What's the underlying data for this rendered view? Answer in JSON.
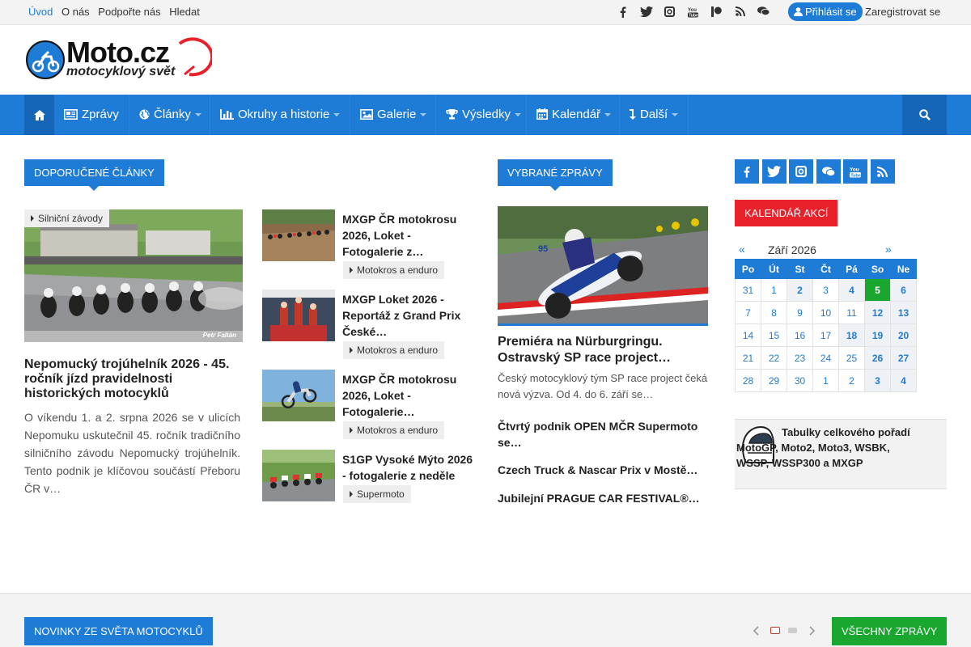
{
  "topbar": {
    "links": [
      "Úvod",
      "O nás",
      "Podpořte nás",
      "Hledat"
    ],
    "social_icons": [
      "facebook-icon",
      "twitter-icon",
      "instagram-icon",
      "youtube-icon",
      "patreon-icon",
      "rss-icon",
      "chat-icon"
    ],
    "login": "Přihlásit se",
    "register": "Zaregistrovat se"
  },
  "logo": {
    "name": "Moto.cz",
    "tagline": "motocyklový svět"
  },
  "nav": {
    "items": [
      {
        "label": "Zprávy",
        "icon": "newspaper-icon",
        "dropdown": false
      },
      {
        "label": "Články",
        "icon": "globe-icon",
        "dropdown": true
      },
      {
        "label": "Okruhy a historie",
        "icon": "bar-chart-icon",
        "dropdown": true
      },
      {
        "label": "Galerie",
        "icon": "image-icon",
        "dropdown": true
      },
      {
        "label": "Výsledky",
        "icon": "trophy-icon",
        "dropdown": true
      },
      {
        "label": "Kalendář",
        "icon": "calendar-icon",
        "dropdown": true
      },
      {
        "label": "Další",
        "icon": "arrow-down-icon",
        "dropdown": true
      }
    ]
  },
  "recommended": {
    "header": "DOPORUČENÉ ČLÁNKY",
    "featured": {
      "badge": "Silniční závody",
      "title": "Nepomucký trojúhelník 2026 - 45. ročník jízd pravidelnosti historických motocyklů",
      "excerpt": "O víkendu 1. a 2. srpna 2026 se v ulicích Nepomuku uskutečnil 45. ročník tradičního silničního závodu Nepomucký trojúhelník. Tento podnik je klíčovou součástí Přeboru ČR v…",
      "photo_credit": "Petr Faltán"
    },
    "list": [
      {
        "title": "MXGP ČR motokrosu 2026, Loket - Fotogalerie z…",
        "badge": "Motokros a enduro"
      },
      {
        "title": "MXGP Loket 2026 - Reportáž z Grand Prix České…",
        "badge": "Motokros a enduro"
      },
      {
        "title": "MXGP ČR motokrosu 2026, Loket - Fotogalerie…",
        "badge": "Motokros a enduro"
      },
      {
        "title": "S1GP Vysoké Mýto 2026 - fotogalerie z neděle",
        "badge": "Supermoto"
      }
    ]
  },
  "selected_news": {
    "header": "VYBRANÉ ZPRÁVY",
    "featured": {
      "title": "Premiéra na Nürburgringu. Ostravský SP race project…",
      "excerpt": "Český motocyklový tým SP race project čeká nová výzva. Od 4. do 6. září se…",
      "bike_number": "95"
    },
    "items": [
      "Čtvrtý podnik OPEN MČR Supermoto se…",
      "Czech Truck & Nascar Prix v Mostě…",
      "Jubilejní PRAGUE CAR FESTIVAL®…"
    ]
  },
  "sidebar": {
    "social_icons": [
      "facebook-icon",
      "twitter-icon",
      "instagram-icon",
      "chat-icon",
      "youtube-icon",
      "rss-icon"
    ],
    "calendar": {
      "header": "KALENDÁŘ AKCÍ",
      "prev": "«",
      "next": "»",
      "month": "Září 2026",
      "weekdays": [
        "Po",
        "Út",
        "St",
        "Čt",
        "Pá",
        "So",
        "Ne"
      ],
      "weeks": [
        [
          {
            "d": "31"
          },
          {
            "d": "1"
          },
          {
            "d": "2",
            "hl": true
          },
          {
            "d": "3"
          },
          {
            "d": "4",
            "hl": true
          },
          {
            "d": "5",
            "today": true
          },
          {
            "d": "6",
            "hl": true
          }
        ],
        [
          {
            "d": "7"
          },
          {
            "d": "8"
          },
          {
            "d": "9"
          },
          {
            "d": "10"
          },
          {
            "d": "11"
          },
          {
            "d": "12",
            "hl": true
          },
          {
            "d": "13",
            "hl": true
          }
        ],
        [
          {
            "d": "14"
          },
          {
            "d": "15"
          },
          {
            "d": "16"
          },
          {
            "d": "17"
          },
          {
            "d": "18",
            "hl": true
          },
          {
            "d": "19",
            "hl": true
          },
          {
            "d": "20",
            "hl": true
          }
        ],
        [
          {
            "d": "21"
          },
          {
            "d": "22"
          },
          {
            "d": "23"
          },
          {
            "d": "24"
          },
          {
            "d": "25"
          },
          {
            "d": "26",
            "hl": true
          },
          {
            "d": "27",
            "hl": true
          }
        ],
        [
          {
            "d": "28"
          },
          {
            "d": "29"
          },
          {
            "d": "30"
          },
          {
            "d": "1"
          },
          {
            "d": "2"
          },
          {
            "d": "3",
            "hl": true
          },
          {
            "d": "4",
            "hl": true
          }
        ]
      ]
    },
    "standings": "Tabulky celkového pořadí MotoGP, Moto2, Moto3, WSBK, WSSP, WSSP300 a MXGP"
  },
  "bottom": {
    "header": "NOVINKY ZE SVĚTA MOTOCYKLŮ",
    "all_news": "VŠECHNY ZPRÁVY"
  },
  "colors": {
    "primary": "#1e7bd6",
    "primary_dark": "#1565b8",
    "accent_red": "#e8212b",
    "today_green": "#1aa72f"
  }
}
